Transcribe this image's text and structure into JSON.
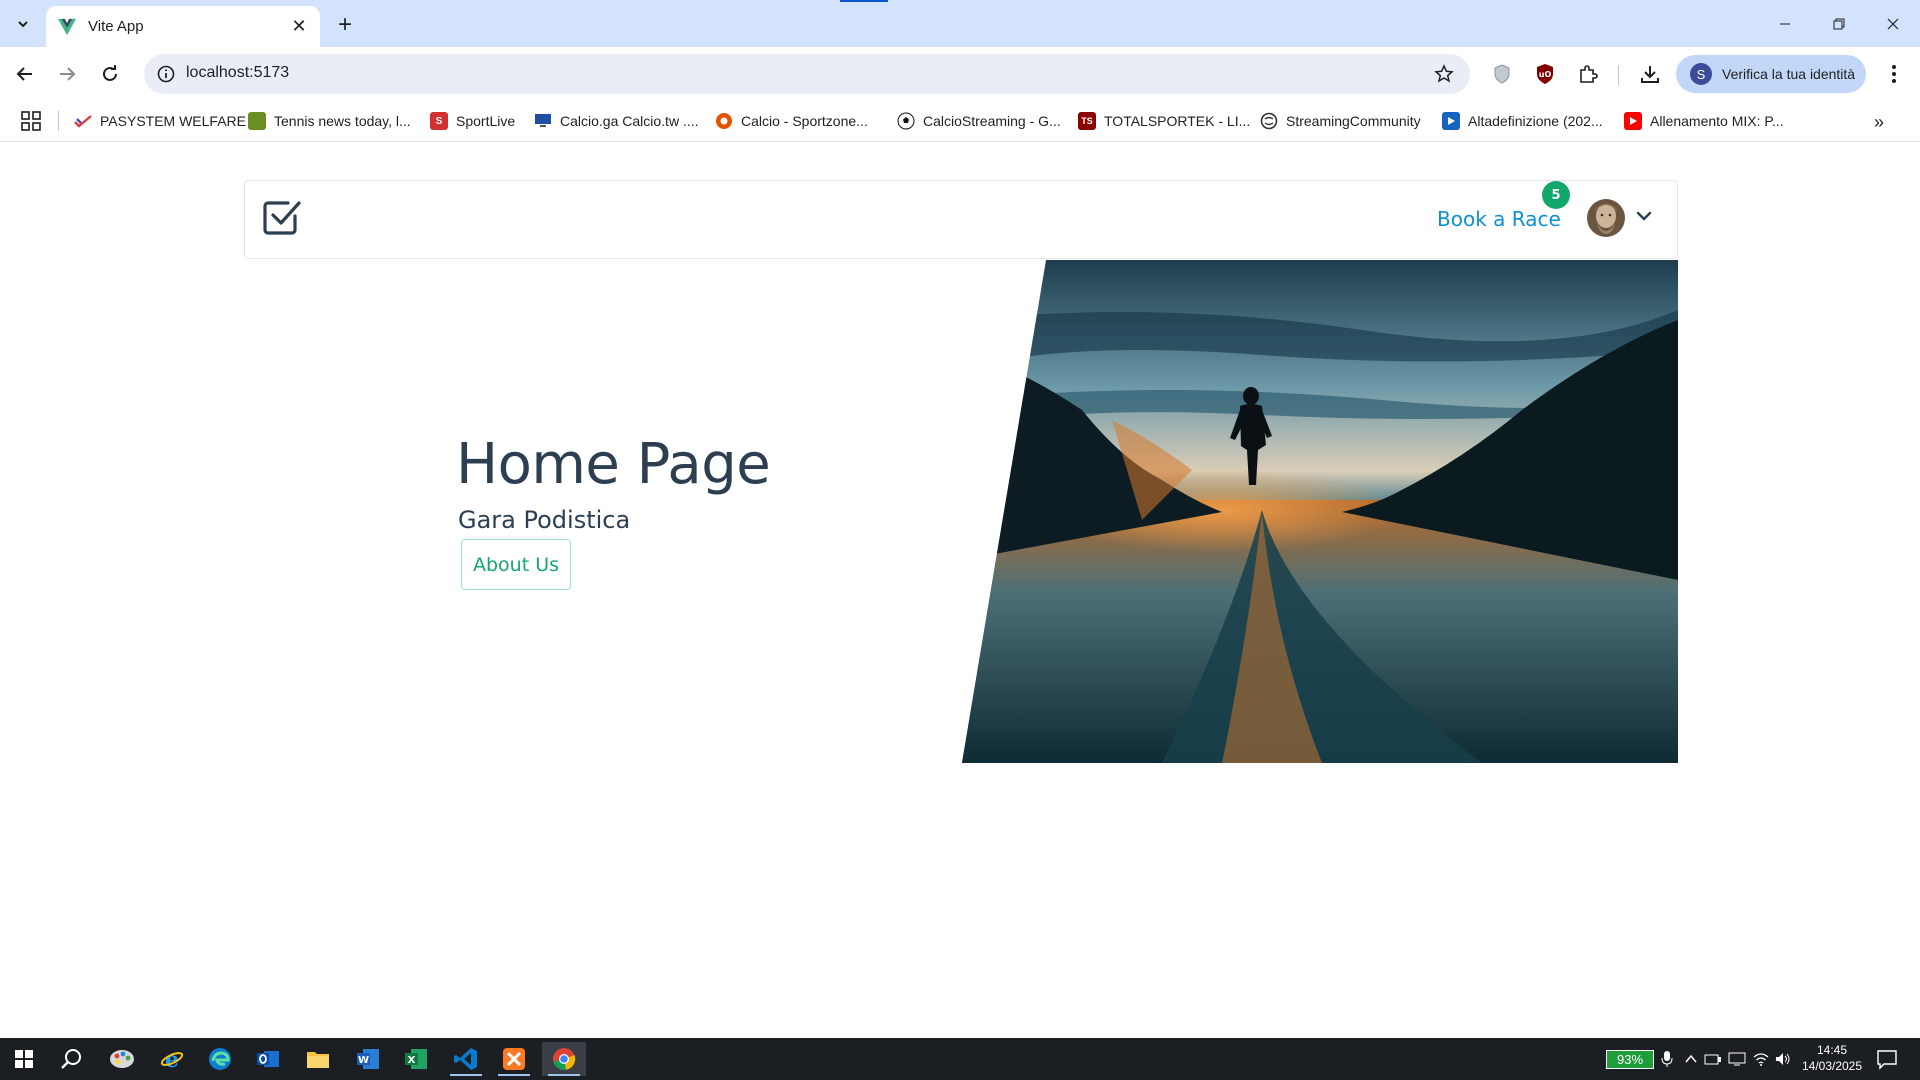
{
  "browser": {
    "tab": {
      "title": "Vite App",
      "close_glyph": "✕"
    },
    "new_tab_glyph": "+",
    "url": "localhost:5173",
    "profile_chip": {
      "initial": "S",
      "label": "Verifica la tua identità"
    },
    "more_bookmarks_glyph": "»"
  },
  "bookmarks": [
    {
      "label": "PASYSTEM WELFARE",
      "icon": "pasystem-icon",
      "color": "#e23b3b"
    },
    {
      "label": "Tennis news today, l...",
      "icon": "tennis-icon",
      "color": "#6b8e23"
    },
    {
      "label": "SportLive",
      "icon": "sportlive-icon",
      "color": "#d32f2f",
      "glyph": "S"
    },
    {
      "label": "Calcio.ga Calcio.tw ....",
      "icon": "monitor-icon",
      "color": "#1e4fa3"
    },
    {
      "label": "Calcio - Sportzone...",
      "icon": "soccer-orange-icon",
      "color": "#e65100"
    },
    {
      "label": "CalcioStreaming - G...",
      "icon": "soccer-ball-icon",
      "color": "#111111"
    },
    {
      "label": "TOTALSPORTEK - LI...",
      "icon": "totalsportek-icon",
      "color": "#8b0000",
      "glyph": "TS"
    },
    {
      "label": "StreamingCommunity",
      "icon": "streamingcommunity-icon",
      "color": "#333333"
    },
    {
      "label": "Altadefinizione (202...",
      "icon": "play-icon",
      "color": "#1565c0"
    },
    {
      "label": "Allenamento MIX: P...",
      "icon": "youtube-icon",
      "color": "#ff0000"
    }
  ],
  "site": {
    "nav": {
      "book_label": "Book a Race",
      "badge_count": "5"
    },
    "hero": {
      "title": "Home Page",
      "subtitle": "Gara Podistica",
      "about_label": "About Us"
    }
  },
  "taskbar": {
    "apps": [
      "start-icon",
      "search-icon",
      "paint-icon",
      "ie-icon",
      "edge-icon",
      "outlook-icon",
      "file-explorer-icon",
      "word-icon",
      "excel-icon",
      "vscode-icon",
      "xampp-icon",
      "chrome-icon"
    ],
    "battery": "93%",
    "time": "14:45",
    "date": "14/03/2025"
  },
  "colors": {
    "accent_blue": "#0d8fd6",
    "accent_green": "#13a86b",
    "heading": "#2c3e50",
    "tab_strip": "#d3e3fd"
  }
}
